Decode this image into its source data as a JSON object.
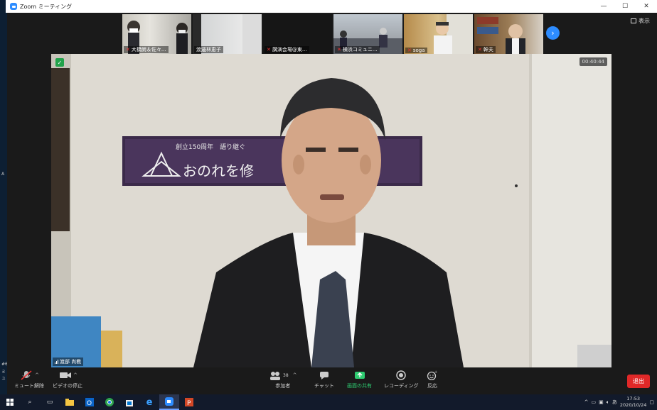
{
  "window": {
    "title": "Zoom ミーティング",
    "minimize": "—",
    "maximize": "☐",
    "close": "✕"
  },
  "left_strip": {
    "a": "A",
    "b": "#6",
    "c": "ミュ"
  },
  "participants": [
    {
      "name": "大橋朗＆佐々..."
    },
    {
      "name": "渡邊林恵子"
    },
    {
      "name": "講演会場@東..."
    },
    {
      "name": "横浜コミュニ..."
    },
    {
      "name": "soga"
    },
    {
      "name": "幹夫"
    }
  ],
  "view_button": {
    "label": "表示"
  },
  "main_video": {
    "timer": "00:40:44",
    "speaker": "渡部 尚教",
    "banner_text": "おのれを修　　　くす",
    "banner_top": "創立150周年　語り継ぐ　　　　　　高等学校"
  },
  "toolbar": {
    "mute": "ミュート解除",
    "video": "ビデオの停止",
    "participants": "参加者",
    "participants_count": "38",
    "chat": "チャット",
    "share": "画面の共有",
    "record": "レコーディング",
    "reactions": "反応",
    "leave": "退出"
  },
  "taskbar": {
    "time": "17:53",
    "date": "2020/10/24",
    "ime": "あ"
  }
}
